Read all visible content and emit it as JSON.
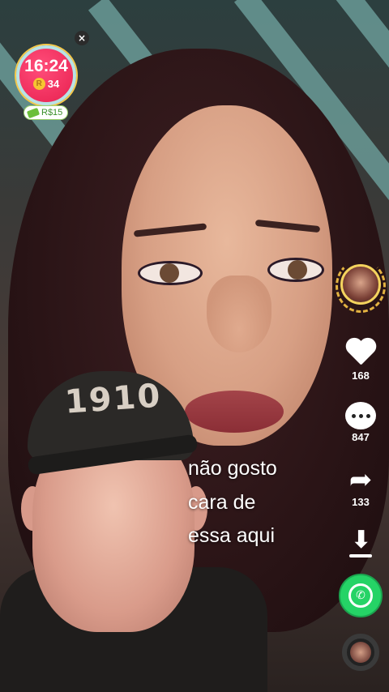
{
  "overlay": {
    "timer_time": "16:24",
    "coin_symbol": "R",
    "coin_count": "34",
    "reward_text": "R$15",
    "close_symbol": "×"
  },
  "video": {
    "cap_text": "1910",
    "caption_lines": [
      "não gosto",
      "cara de",
      "essa aqui"
    ]
  },
  "actions": {
    "likes": "168",
    "comments": "847",
    "shares": "133"
  },
  "colors": {
    "accent_whatsapp": "#25d366",
    "timer_red": "#e8204f",
    "reward_green": "#6bbf3a"
  },
  "icons": [
    "close-icon",
    "coin-icon",
    "cash-icon",
    "heart-icon",
    "comment-icon",
    "share-icon",
    "download-icon",
    "whatsapp-icon",
    "music-disc-icon"
  ]
}
